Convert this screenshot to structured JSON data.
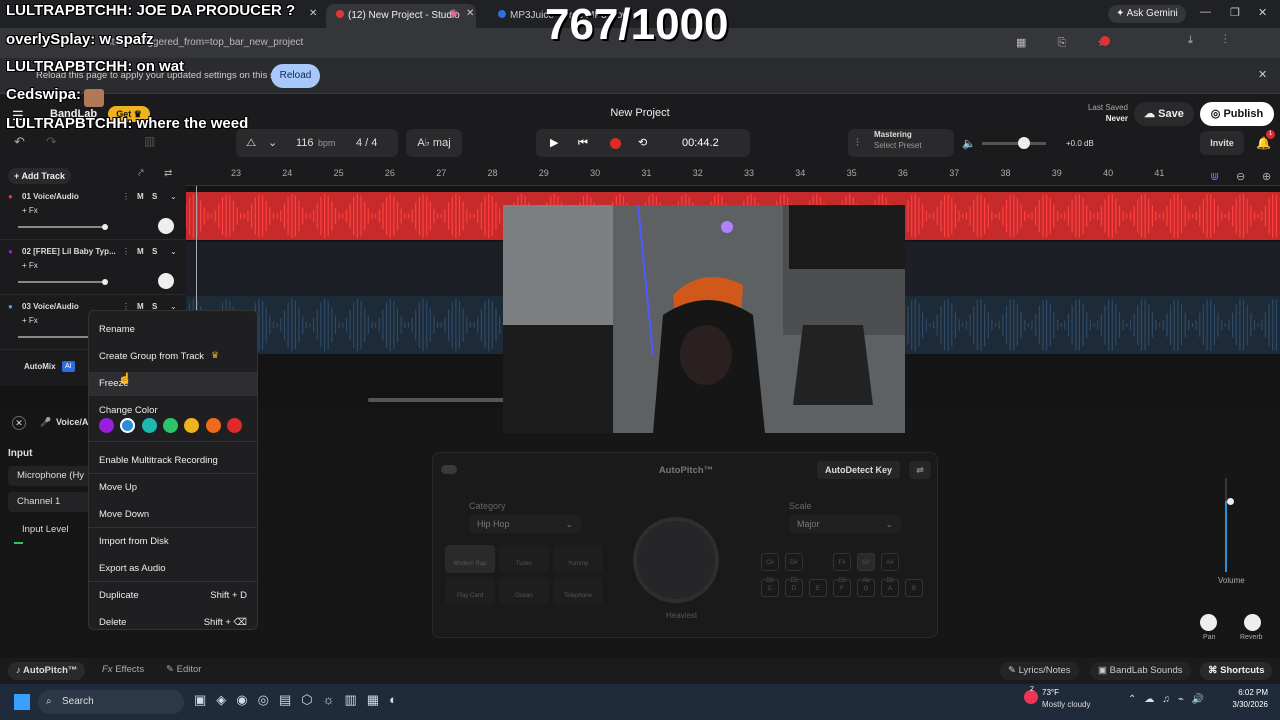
{
  "browser": {
    "tabs": [
      {
        "label": "(12) New Project - Studio"
      },
      {
        "label": "MP3Juice - Free MP3 Downlo"
      }
    ],
    "url": "/studio?triggered_from=top_bar_new_project",
    "ask_gemini": "Ask Gemini",
    "infobar_text": "Reload this page to apply your updated settings on this site",
    "reload_label": "Reload"
  },
  "overlay": {
    "score": "767/1000",
    "chat": [
      {
        "user": "LULTRAPBTCHH:",
        "msg": "JOE DA PRODUCER ?"
      },
      {
        "user": "overlySplay:",
        "msg": "w spafz"
      },
      {
        "user": "LULTRAPBTCHH:",
        "msg": "on wat"
      },
      {
        "user": "Cedswipa:",
        "msg": ""
      },
      {
        "user": "LULTRAPBTCHH:",
        "msg": "where the weed"
      }
    ]
  },
  "header": {
    "logo": "BandLab",
    "get_label": "Get",
    "project_title": "New Project",
    "last_saved_label": "Last Saved",
    "last_saved_value": "Never",
    "save_label": "Save",
    "publish_label": "Publish",
    "bpm": "116",
    "bpm_unit": "bpm",
    "time_sig": "4 / 4",
    "key": "A♭ maj",
    "time": "00:44.2",
    "mastering_label": "Mastering",
    "mastering_preset": "Select Preset",
    "volume_db": "+0.0 dB",
    "invite_label": "Invite",
    "notif_count": "1"
  },
  "ruler": [
    "23",
    "24",
    "25",
    "26",
    "27",
    "28",
    "29",
    "30",
    "31",
    "32",
    "33",
    "34",
    "35",
    "36",
    "37",
    "38",
    "39",
    "40",
    "41"
  ],
  "tracks": [
    {
      "num": "01",
      "name": "Voice/Audio",
      "fx": "+ Fx"
    },
    {
      "num": "02",
      "name": "[FREE] Lil Baby Typ...",
      "fx": "+ Fx"
    },
    {
      "num": "03",
      "name": "Voice/Audio",
      "fx": "+ Fx"
    }
  ],
  "track_controls": {
    "mute": "M",
    "solo": "S",
    "add_track": "Add Track",
    "automix": "AutoMix",
    "ai": "AI"
  },
  "context_menu": {
    "items": [
      {
        "label": "Rename",
        "shortcut": ""
      },
      {
        "label": "Create Group from Track",
        "shortcut": ""
      },
      {
        "label": "Freeze",
        "shortcut": ""
      },
      {
        "label": "Change Color",
        "shortcut": ""
      },
      {
        "label": "Enable Multitrack Recording",
        "shortcut": ""
      },
      {
        "label": "Move Up",
        "shortcut": ""
      },
      {
        "label": "Move Down",
        "shortcut": ""
      },
      {
        "label": "Import from Disk",
        "shortcut": ""
      },
      {
        "label": "Export as Audio",
        "shortcut": ""
      },
      {
        "label": "Duplicate",
        "shortcut": "Shift + D"
      },
      {
        "label": "Delete",
        "shortcut": "Shift + ⌫"
      }
    ],
    "colors": [
      "#9b1ee0",
      "#2b8fd6",
      "#1fb8b0",
      "#2ac46a",
      "#f0b31d",
      "#f06a1d",
      "#e02a2a"
    ]
  },
  "panel": {
    "track_label": "Voice/A",
    "input_label": "Input",
    "input_device": "Microphone (Hy",
    "channel": "Channel 1",
    "input_level": "Input Level",
    "autopitch_title": "AutoPitch™",
    "autodetect": "AutoDetect Key",
    "category_label": "Category",
    "category_value": "Hip Hop",
    "scale_label": "Scale",
    "scale_value": "Major",
    "presets": [
      "Modern Rap",
      "Tunes",
      "Yummy",
      "Play Card",
      "Ocean",
      "Telephone"
    ],
    "knob_label": "Heaviest",
    "notes": [
      "C# Db",
      "D# Eb",
      "F# Gb",
      "G# Ab",
      "A# Bb",
      "C",
      "D",
      "E",
      "F",
      "G",
      "A",
      "B"
    ],
    "volume": "Volume",
    "pan": "Pan",
    "reverb": "Reverb"
  },
  "footer": {
    "tabs": [
      "AutoPitch™",
      "Effects",
      "Editor"
    ],
    "right": [
      "Lyrics/Notes",
      "BandLab Sounds",
      "Shortcuts"
    ]
  },
  "taskbar": {
    "search": "Search",
    "weather_temp": "73°F",
    "weather_desc": "Mostly cloudy",
    "time": "6:02 PM",
    "date": "3/30/2026",
    "weather_badge": "2"
  }
}
